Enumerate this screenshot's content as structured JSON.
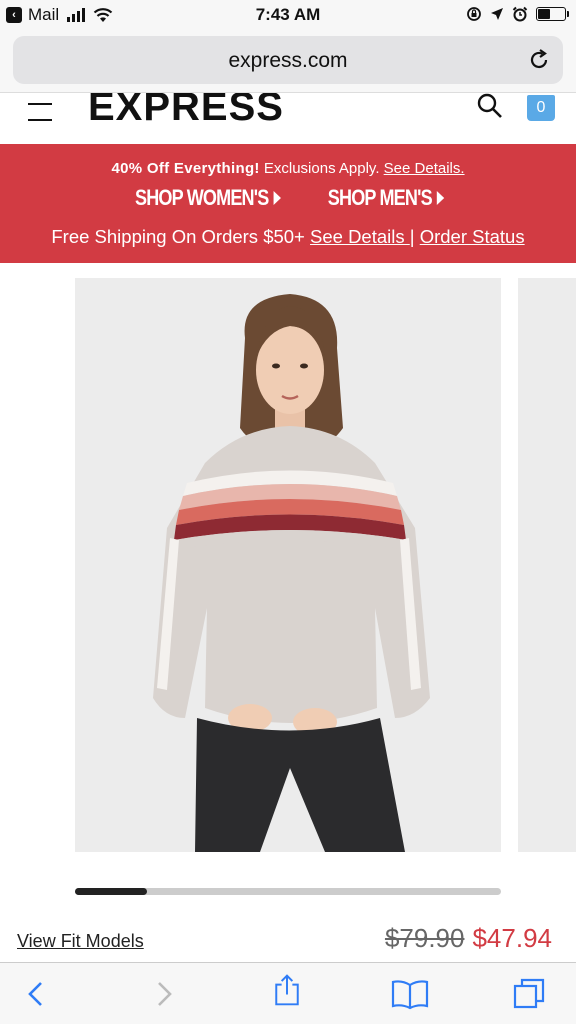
{
  "status_bar": {
    "back_app": "Mail",
    "time": "7:43 AM",
    "battery_level": 0.5
  },
  "browser": {
    "url": "express.com"
  },
  "site_header": {
    "logo": "EXPRESS",
    "bag_count": "0"
  },
  "promo": {
    "headline": "40% Off Everything!",
    "exclusions": " Exclusions Apply. ",
    "see_details_1": "See Details.",
    "shop_women": "SHOP WOMEN'S",
    "shop_men": "SHOP MEN'S",
    "free_shipping": "Free Shipping On Orders $50+ ",
    "see_details_2": "See Details ",
    "separator": " | ",
    "order_status": "Order Status"
  },
  "product": {
    "carousel_progress": 0.17,
    "view_fit_models": "View Fit Models",
    "original_price": "$79.90",
    "sale_price": "$47.94"
  },
  "toolbar": {
    "icons": [
      "back-icon",
      "forward-icon",
      "share-icon",
      "bookmarks-icon",
      "tabs-icon"
    ]
  },
  "colors": {
    "promo_red": "#d23b43",
    "link_blue": "#2f7cf6",
    "bag_blue": "#5aa9e6"
  }
}
